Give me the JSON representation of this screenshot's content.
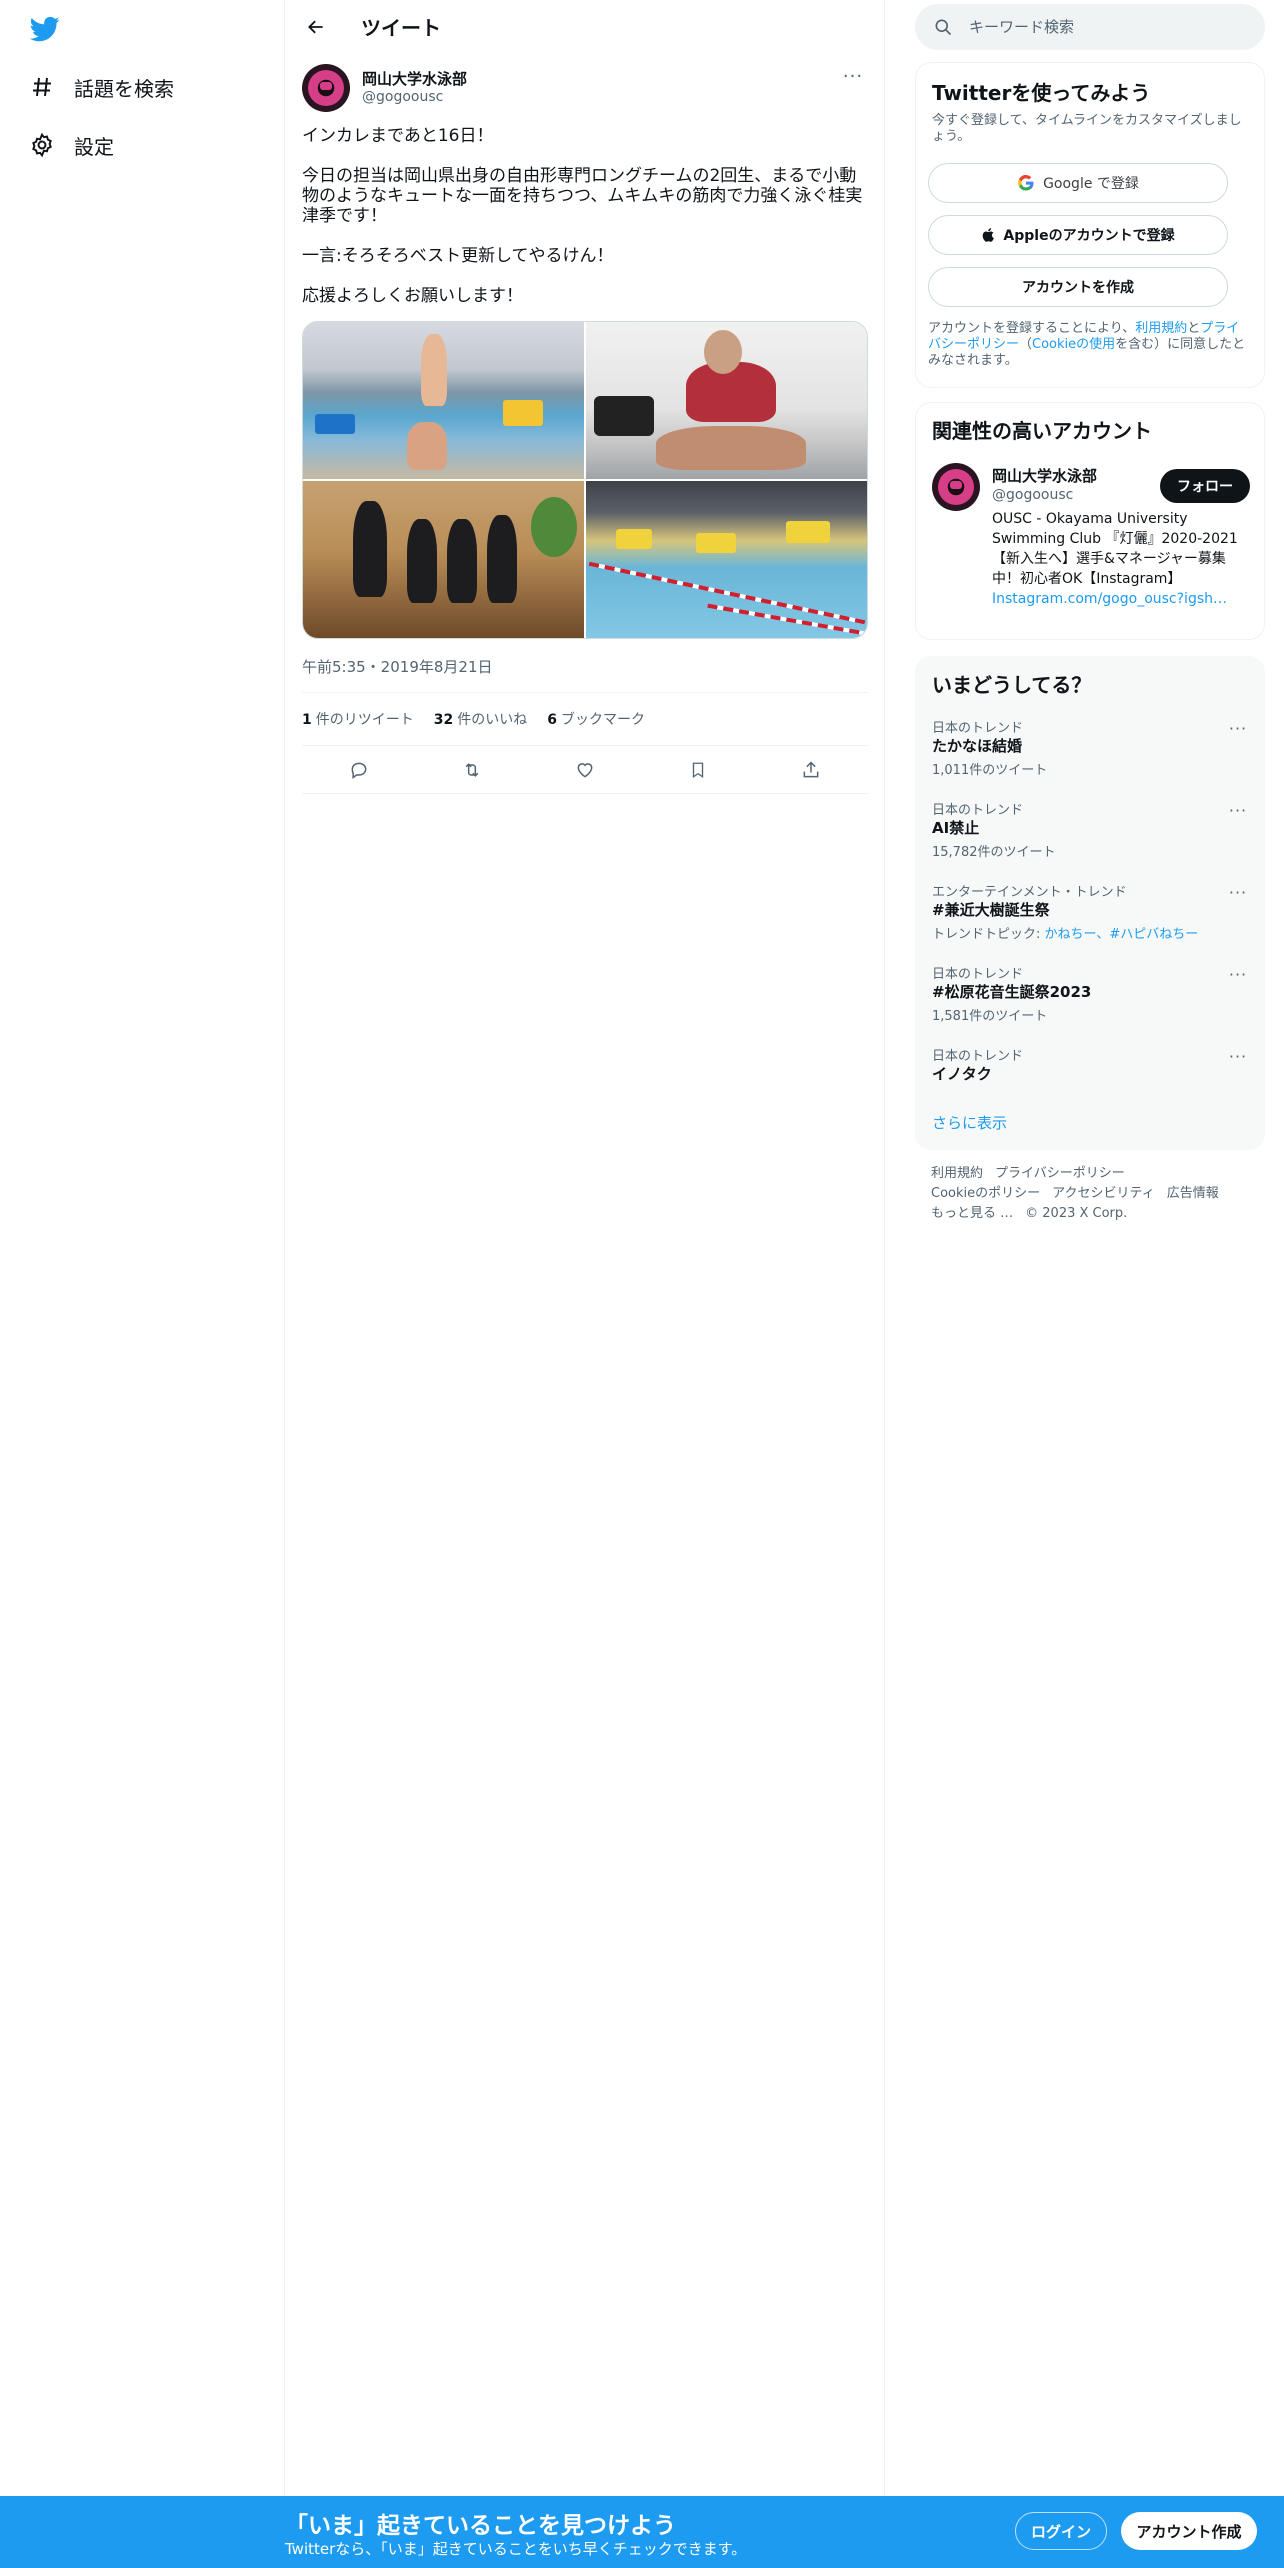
{
  "sidebar": {
    "logo": "twitter-bird-icon",
    "items": [
      {
        "label": "話題を検索",
        "icon": "hashtag-icon"
      },
      {
        "label": "設定",
        "icon": "gear-icon"
      }
    ]
  },
  "main": {
    "title": "ツイート",
    "tweet": {
      "author_name": "岡山大学水泳部",
      "author_handle": "@gogoousc",
      "paragraphs": [
        "インカレまであと16日！",
        "今日の担当は岡山県出身の自由形専門ロングチームの2回生、まるで小動物のようなキュートな一面を持ちつつ、ムキムキの筋肉で力強く泳ぐ桂実津季です！",
        "一言:そろそろベスト更新してやるけん！",
        "応援よろしくお願いします！"
      ],
      "timestamp": "午前5:35・2019年8月21日",
      "stats": {
        "retweets_count": "1",
        "retweets_label": "件のリツイート",
        "likes_count": "32",
        "likes_label": "件のいいね",
        "bookmarks_count": "6",
        "bookmarks_label": "ブックマーク"
      }
    }
  },
  "right": {
    "search": {
      "placeholder": "キーワード検索"
    },
    "signup": {
      "title": "Twitterを使ってみよう",
      "subtitle": "今すぐ登録して、タイムラインをカスタマイズしましょう。",
      "google_label": "Google で登録",
      "apple_label": "Appleのアカウントで登録",
      "create_label": "アカウントを作成",
      "terms_prefix": "アカウントを登録することにより、",
      "terms_link": "利用規約",
      "terms_and": "と",
      "privacy_link": "プライバシーポリシー",
      "paren_open": "（",
      "cookie_link": "Cookieの使用",
      "terms_suffix": "を含む）に同意したとみなされます。"
    },
    "related": {
      "title": "関連性の高いアカウント",
      "name": "岡山大学水泳部",
      "handle": "@gogoousc",
      "follow_label": "フォロー",
      "bio": "OUSC - Okayama University Swimming Club 『灯儷』2020-2021【新入生へ】選手&マネージャー募集中！初心者OK【Instagram】",
      "bio_link": "Instagram.com/gogo_ousc?igsh…"
    },
    "trends": {
      "title": "いまどうしてる？",
      "items": [
        {
          "context": "日本のトレンド",
          "name": "たかなほ結婚",
          "count": "1,011件のツイート"
        },
        {
          "context": "日本のトレンド",
          "name": "AI禁止",
          "count": "15,782件のツイート"
        },
        {
          "context": "エンターテインメント・トレンド",
          "name": "#兼近大樹誕生祭",
          "topic_prefix": "トレンドトピック: ",
          "topic_links": "かねちー、#ハピバねちー"
        },
        {
          "context": "日本のトレンド",
          "name": "#松原花音生誕祭2023",
          "count": "1,581件のツイート"
        },
        {
          "context": "日本のトレンド",
          "name": "イノタク",
          "count": ""
        }
      ],
      "show_more": "さらに表示"
    },
    "footer": {
      "links": [
        "利用規約",
        "プライバシーポリシー",
        "Cookieのポリシー",
        "アクセシビリティ",
        "広告情報",
        "もっと見る …"
      ],
      "copyright": "© 2023 X Corp."
    }
  },
  "bottom_bar": {
    "title": "「いま」起きていることを見つけよう",
    "subtitle": "Twitterなら、「いま」起きていることをいち早くチェックできます。",
    "login_label": "ログイン",
    "signup_label": "アカウント作成"
  },
  "colors": {
    "accent": "#1d9bf0",
    "text_primary": "#0f1419",
    "text_secondary": "#536471",
    "border": "#eff3f4",
    "follow_button": "#0f1419"
  }
}
